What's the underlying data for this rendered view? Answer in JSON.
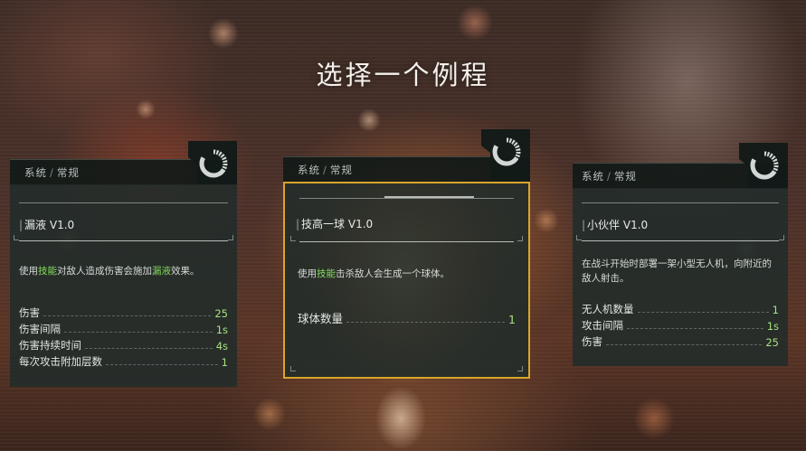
{
  "page_title": "选择一个例程",
  "colors": {
    "selected_border": "#d8a52a",
    "highlight": "#84d95c",
    "value": "#a6e07f",
    "panel": "#222c2a"
  },
  "cards": [
    {
      "cat_main": "系统",
      "cat_sep": "/",
      "cat_sub": "常规",
      "name": "漏液 V1.0",
      "desc_parts": [
        "使用",
        "技能",
        "对敌人造成伤害会施加",
        "漏液",
        "效果。"
      ],
      "stats": [
        {
          "label": "伤害",
          "value": "25"
        },
        {
          "label": "伤害间隔",
          "value": "1s"
        },
        {
          "label": "伤害持续时间",
          "value": "4s"
        },
        {
          "label": "每次攻击附加层数",
          "value": "1"
        }
      ],
      "icon": "loading-ring-icon"
    },
    {
      "cat_main": "系统",
      "cat_sep": "/",
      "cat_sub": "常规",
      "name": "技高一球 V1.0",
      "desc_parts": [
        "使用",
        "技能",
        "击杀敌人会生成一个球体。"
      ],
      "stats": [
        {
          "label": "球体数量",
          "value": "1"
        }
      ],
      "icon": "loading-ring-icon",
      "selected": true
    },
    {
      "cat_main": "系统",
      "cat_sep": "/",
      "cat_sub": "常规",
      "name": "小伙伴 V1.0",
      "desc_parts": [
        "在战斗开始时部署一架小型无人机，向附近的敌人射击。"
      ],
      "stats": [
        {
          "label": "无人机数量",
          "value": "1"
        },
        {
          "label": "攻击间隔",
          "value": "1s"
        },
        {
          "label": "伤害",
          "value": "25"
        }
      ],
      "icon": "loading-ring-icon"
    }
  ]
}
